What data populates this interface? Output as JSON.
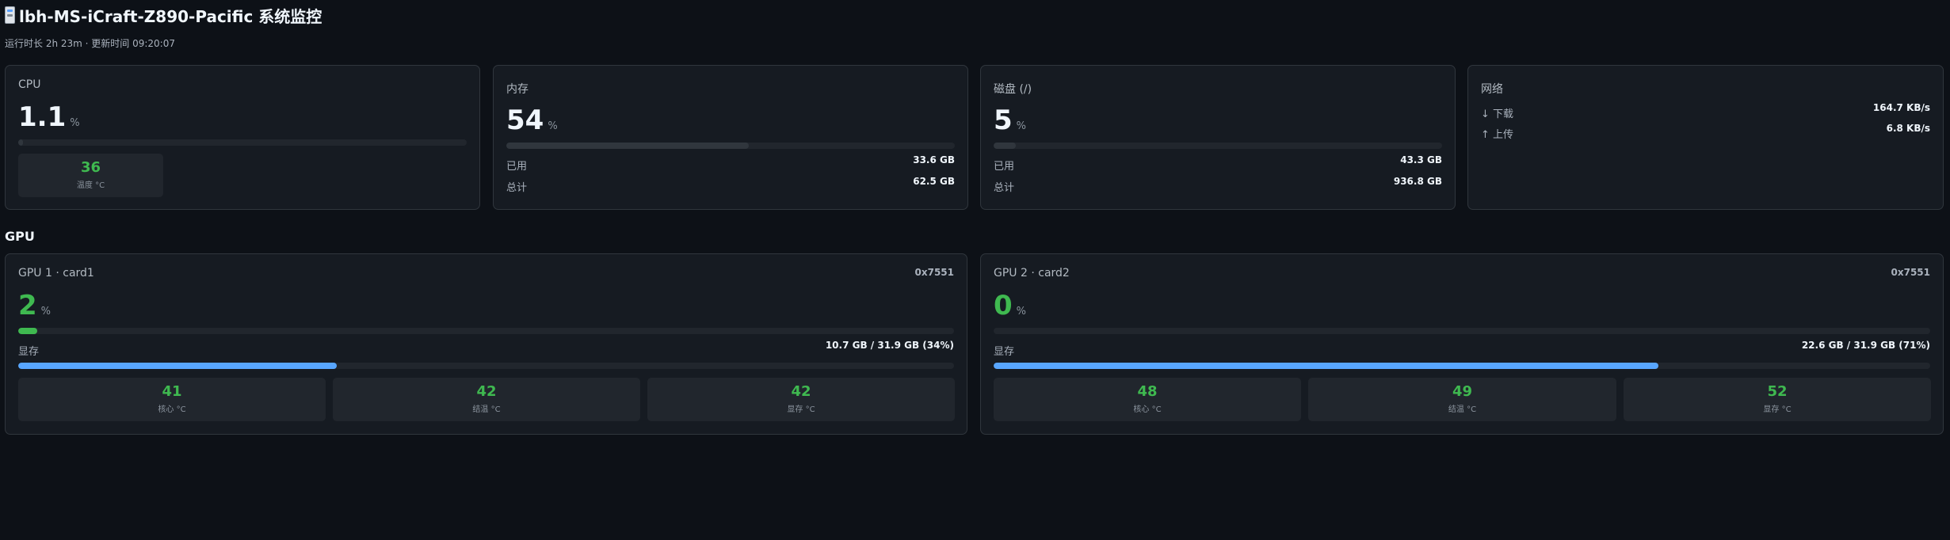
{
  "header": {
    "title": "lbh-MS-iCraft-Z890-Pacific 系统监控",
    "subtitle": "运行时长 2h 23m · 更新时间 09:20:07",
    "icon": "server-icon"
  },
  "cpu": {
    "title": "CPU",
    "value": "1.1",
    "unit": "%",
    "usage_percent": 1.1,
    "temp": {
      "value": "36",
      "label": "温度 °C"
    }
  },
  "memory": {
    "title": "内存",
    "value": "54",
    "unit": "%",
    "usage_percent": 54,
    "used_label": "已用",
    "used_value": "33.6 GB",
    "total_label": "总计",
    "total_value": "62.5 GB"
  },
  "disk": {
    "title": "磁盘 (/)",
    "value": "5",
    "unit": "%",
    "usage_percent": 5,
    "used_label": "已用",
    "used_value": "43.3 GB",
    "total_label": "总计",
    "total_value": "936.8 GB"
  },
  "network": {
    "title": "网络",
    "download_label": "↓ 下载",
    "download_value": "164.7 KB/s",
    "upload_label": "↑ 上传",
    "upload_value": "6.8 KB/s"
  },
  "gpu_section": {
    "title": "GPU"
  },
  "gpus": [
    {
      "title": "GPU 1 · card1",
      "id": "0x7551",
      "value": "2",
      "unit": "%",
      "usage_percent": 2,
      "vram_label": "显存",
      "vram_value": "10.7 GB / 31.9 GB (34%)",
      "vram_percent": 34,
      "temps": [
        {
          "value": "41",
          "label": "核心 °C"
        },
        {
          "value": "42",
          "label": "结温 °C"
        },
        {
          "value": "42",
          "label": "显存 °C"
        }
      ]
    },
    {
      "title": "GPU 2 · card2",
      "id": "0x7551",
      "value": "0",
      "unit": "%",
      "usage_percent": 0,
      "vram_label": "显存",
      "vram_value": "22.6 GB / 31.9 GB (71%)",
      "vram_percent": 71,
      "temps": [
        {
          "value": "48",
          "label": "核心 °C"
        },
        {
          "value": "49",
          "label": "结温 °C"
        },
        {
          "value": "52",
          "label": "显存 °C"
        }
      ]
    }
  ],
  "colors": {
    "background": "#0d1117",
    "card": "#161b22",
    "green": "#3fb950",
    "blue": "#58a6ff"
  }
}
